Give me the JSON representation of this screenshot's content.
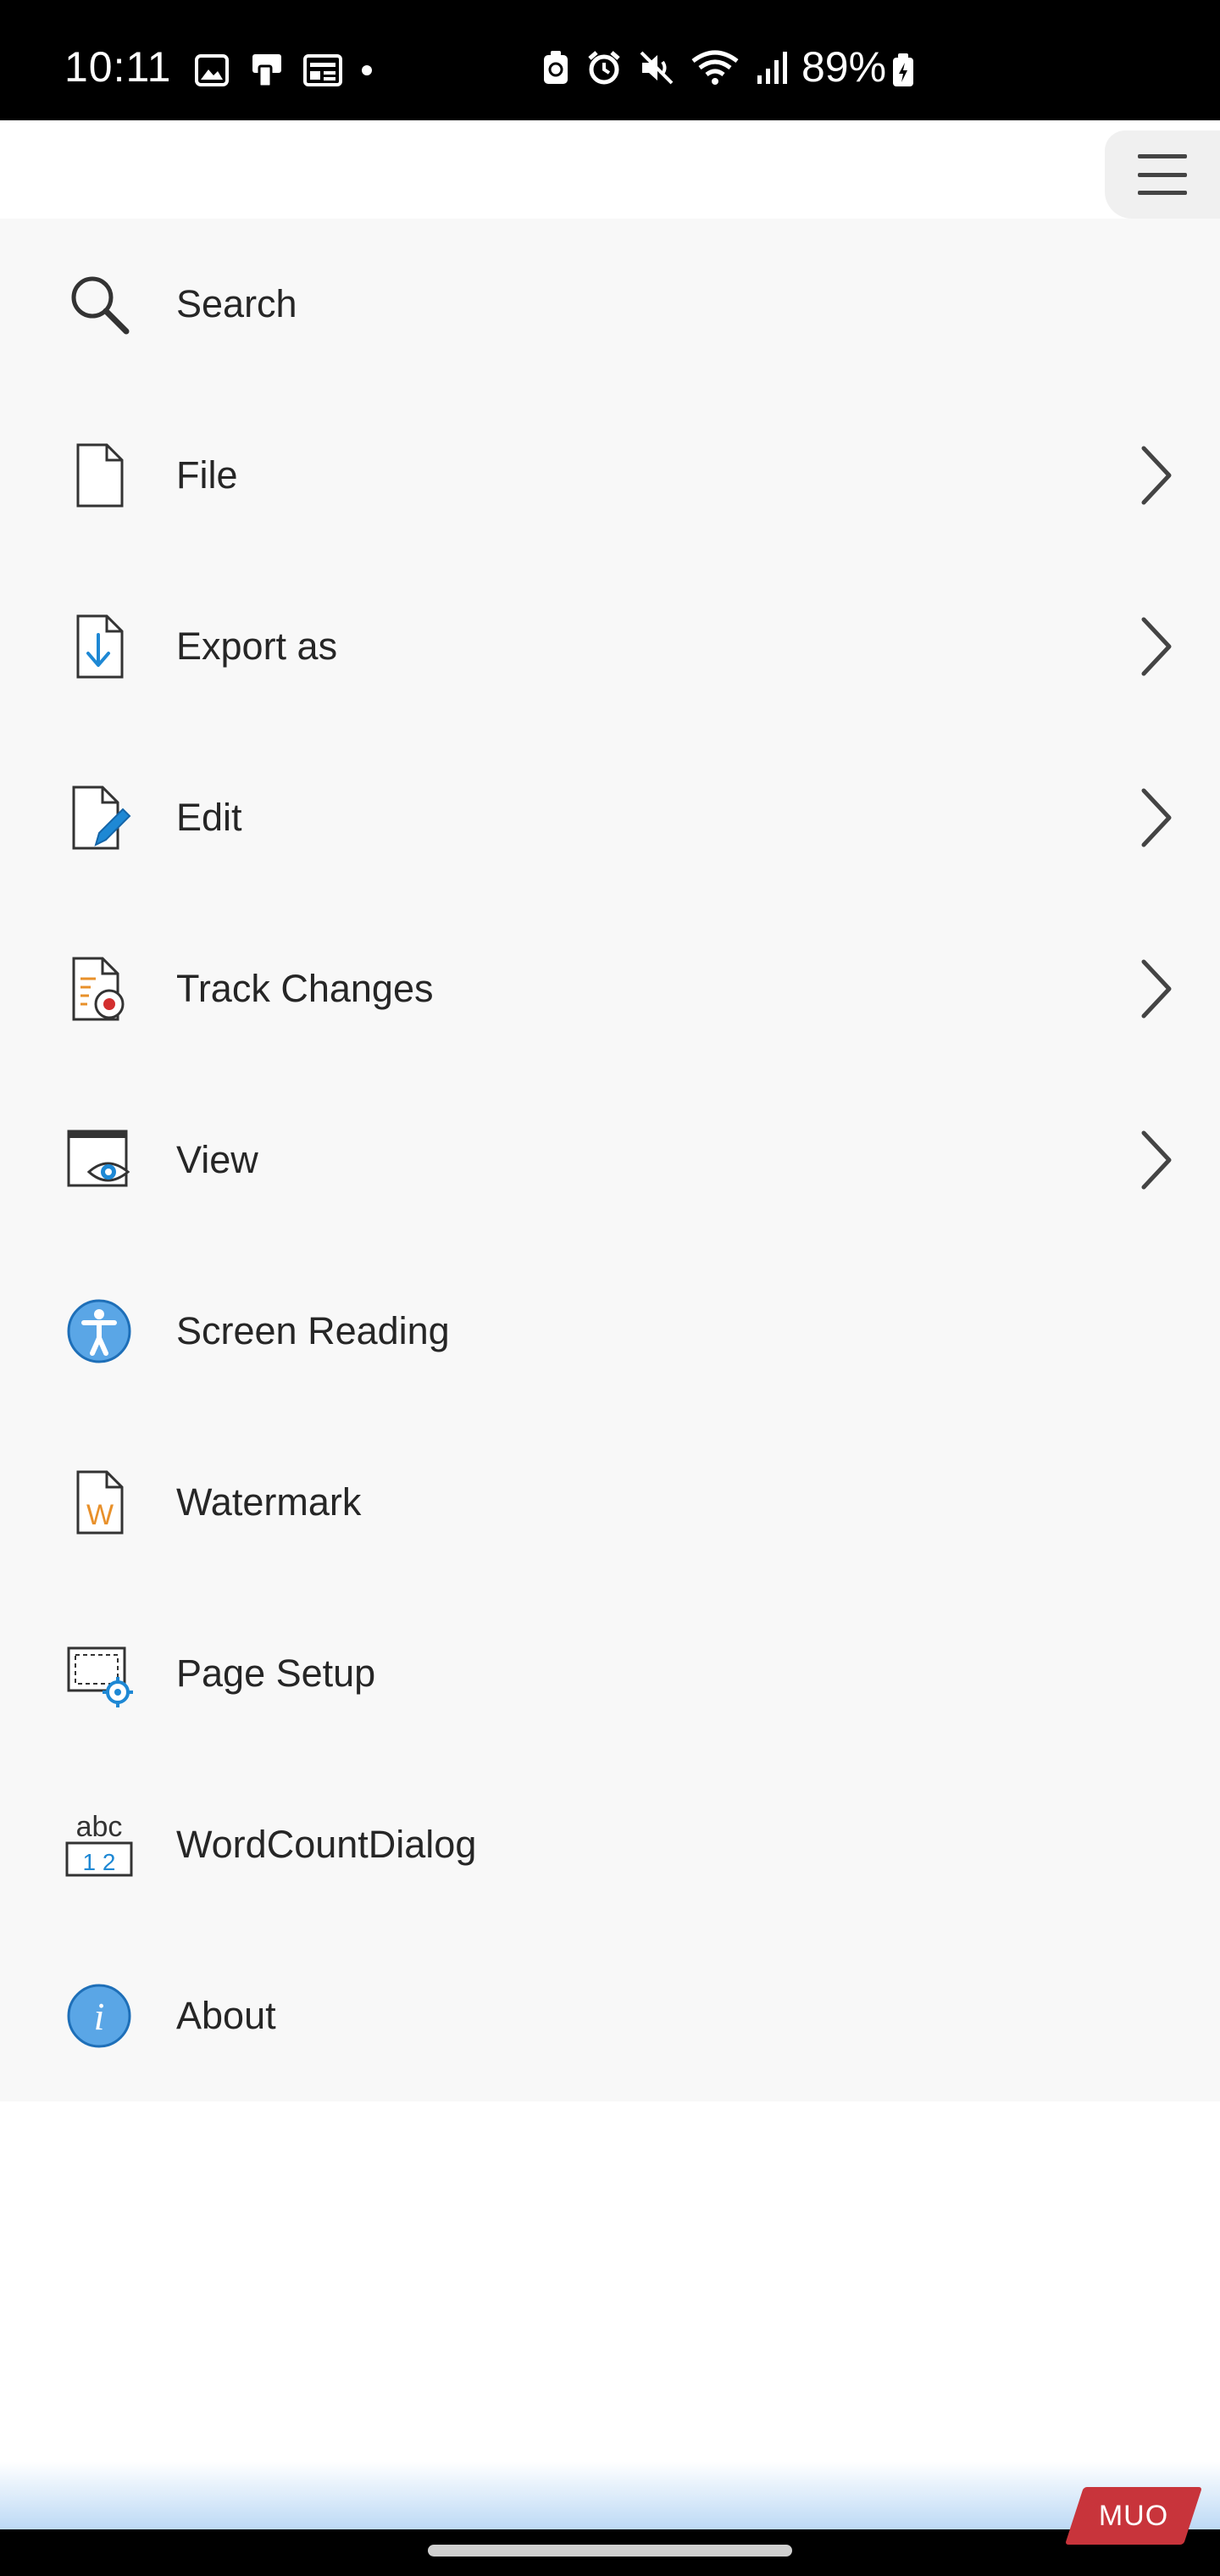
{
  "status_bar": {
    "time": "10:11",
    "battery": "89%",
    "left_icons": [
      "gallery-icon",
      "cast-icon",
      "news-icon",
      "dot-icon"
    ],
    "right_icons": [
      "battery-saver-icon",
      "alarm-icon",
      "mute-icon",
      "wifi-icon",
      "signal-icon"
    ]
  },
  "toolbar": {
    "menu_icon": "hamburger-icon"
  },
  "menu": {
    "items": [
      {
        "label": "Search",
        "icon": "search-icon",
        "has_submenu": false
      },
      {
        "label": "File",
        "icon": "file-icon",
        "has_submenu": true
      },
      {
        "label": "Export as",
        "icon": "export-icon",
        "has_submenu": true
      },
      {
        "label": "Edit",
        "icon": "edit-icon",
        "has_submenu": true
      },
      {
        "label": "Track Changes",
        "icon": "track-changes-icon",
        "has_submenu": true
      },
      {
        "label": "View",
        "icon": "view-icon",
        "has_submenu": true
      },
      {
        "label": "Screen Reading",
        "icon": "accessibility-icon",
        "has_submenu": false
      },
      {
        "label": "Watermark",
        "icon": "watermark-icon",
        "has_submenu": false
      },
      {
        "label": "Page Setup",
        "icon": "page-setup-icon",
        "has_submenu": false
      },
      {
        "label": "WordCountDialog",
        "icon": "word-count-icon",
        "has_submenu": false
      },
      {
        "label": "About",
        "icon": "info-icon",
        "has_submenu": false
      }
    ]
  },
  "icon_text": {
    "word_count_top": "abc",
    "word_count_bottom": "1 2",
    "watermark_letter": "W",
    "info_letter": "i"
  },
  "watermark_logo": "MUO",
  "colors": {
    "accent_blue": "#1e88d4",
    "record_red": "#d32f2f",
    "watermark_orange": "#e8902a",
    "panel_bg": "#f8f8f8"
  }
}
